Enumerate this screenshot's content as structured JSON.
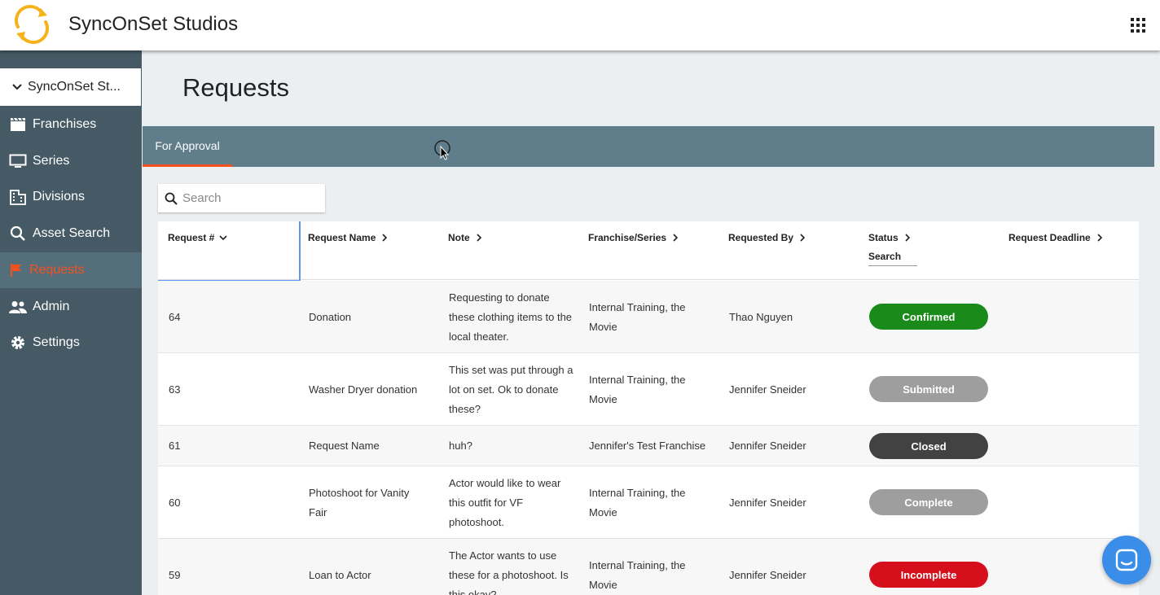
{
  "app": {
    "title": "SyncOnSet Studios"
  },
  "sidebar": {
    "studio": "SyncOnSet St...",
    "items": [
      {
        "label": "Franchises",
        "icon": "clapperboard-icon",
        "active": false
      },
      {
        "label": "Series",
        "icon": "monitor-icon",
        "active": false
      },
      {
        "label": "Divisions",
        "icon": "building-icon",
        "active": false
      },
      {
        "label": "Asset Search",
        "icon": "search-icon",
        "active": false
      },
      {
        "label": "Requests",
        "icon": "flag-icon",
        "active": true
      },
      {
        "label": "Admin",
        "icon": "people-icon",
        "active": false
      },
      {
        "label": "Settings",
        "icon": "gear-icon",
        "active": false
      }
    ]
  },
  "main": {
    "title": "Requests",
    "tabs": [
      {
        "label": "For Approval"
      }
    ],
    "search": {
      "placeholder": "Search",
      "value": ""
    }
  },
  "table": {
    "columns": [
      "Request #",
      "Request Name",
      "Note",
      "Franchise/Series",
      "Requested By",
      "Status",
      "Request Deadline"
    ],
    "status_filter": "Search",
    "rows": [
      {
        "id": "64",
        "name": "Donation",
        "note": "Requesting to donate these clothing items to the local theater.",
        "franchise": "Internal Training, the Movie",
        "requested_by": "Thao Nguyen",
        "status": "Confirmed",
        "deadline": ""
      },
      {
        "id": "63",
        "name": "Washer Dryer donation",
        "note": "This set was put through a lot on set. Ok to donate these?",
        "franchise": "Internal Training, the Movie",
        "requested_by": "Jennifer Sneider",
        "status": "Submitted",
        "deadline": ""
      },
      {
        "id": "61",
        "name": "Request Name",
        "note": "huh?",
        "franchise": "Jennifer's Test Franchise",
        "requested_by": "Jennifer Sneider",
        "status": "Closed",
        "deadline": ""
      },
      {
        "id": "60",
        "name": "Photoshoot for Vanity Fair",
        "note": "Actor would like to wear this outfit for VF photoshoot.",
        "franchise": "Internal Training, the Movie",
        "requested_by": "Jennifer Sneider",
        "status": "Complete",
        "deadline": ""
      },
      {
        "id": "59",
        "name": "Loan to Actor",
        "note": "The Actor wants to use these for a photoshoot. Is this okay?",
        "franchise": "Internal Training, the Movie",
        "requested_by": "Jennifer Sneider",
        "status": "Incomplete",
        "deadline": ""
      }
    ]
  },
  "colors": {
    "accent": "#f4511e",
    "sidebar": "#455a64",
    "tabbar": "#607d8b",
    "confirmed": "#1a8a1a",
    "submitted": "#9e9e9e",
    "closed": "#424242",
    "complete": "#9e9e9e",
    "incomplete": "#d50f1b"
  }
}
